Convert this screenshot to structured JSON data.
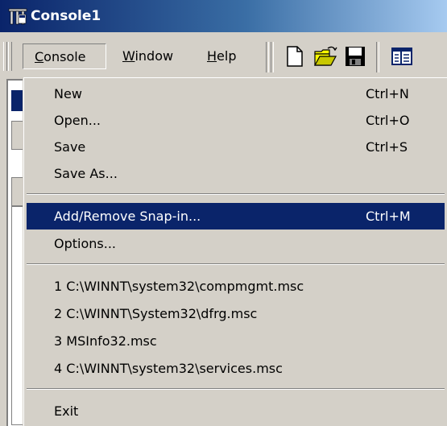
{
  "window": {
    "title": "Console1"
  },
  "menubar": {
    "items": [
      {
        "label": "Console",
        "accel_char": "C",
        "rest": "onsole"
      },
      {
        "label": "Window",
        "accel_char": "W",
        "rest": "indow"
      },
      {
        "label": "Help",
        "accel_char": "H",
        "rest": "elp"
      }
    ]
  },
  "toolbar": {
    "icons": [
      "new-document-icon",
      "open-folder-icon",
      "save-icon",
      "show-hide-console-tree-icon"
    ]
  },
  "console_menu": {
    "items": [
      {
        "label": "New",
        "shortcut": "Ctrl+N"
      },
      {
        "label": "Open...",
        "shortcut": "Ctrl+O"
      },
      {
        "label": "Save",
        "shortcut": "Ctrl+S"
      },
      {
        "label": "Save As...",
        "shortcut": ""
      },
      {
        "label": "Add/Remove Snap-in...",
        "shortcut": "Ctrl+M",
        "highlighted": true
      },
      {
        "label": "Options...",
        "shortcut": ""
      },
      {
        "label": "1 C:\\WINNT\\system32\\compmgmt.msc",
        "shortcut": ""
      },
      {
        "label": "2 C:\\WINNT\\System32\\dfrg.msc",
        "shortcut": ""
      },
      {
        "label": "3 MSInfo32.msc",
        "shortcut": ""
      },
      {
        "label": "4 C:\\WINNT\\system32\\services.msc",
        "shortcut": ""
      },
      {
        "label": "Exit",
        "shortcut": ""
      }
    ]
  },
  "colors": {
    "title_start": "#0a246a",
    "title_end": "#a6caf0",
    "highlight": "#0a246a",
    "face": "#d4d0c8"
  }
}
